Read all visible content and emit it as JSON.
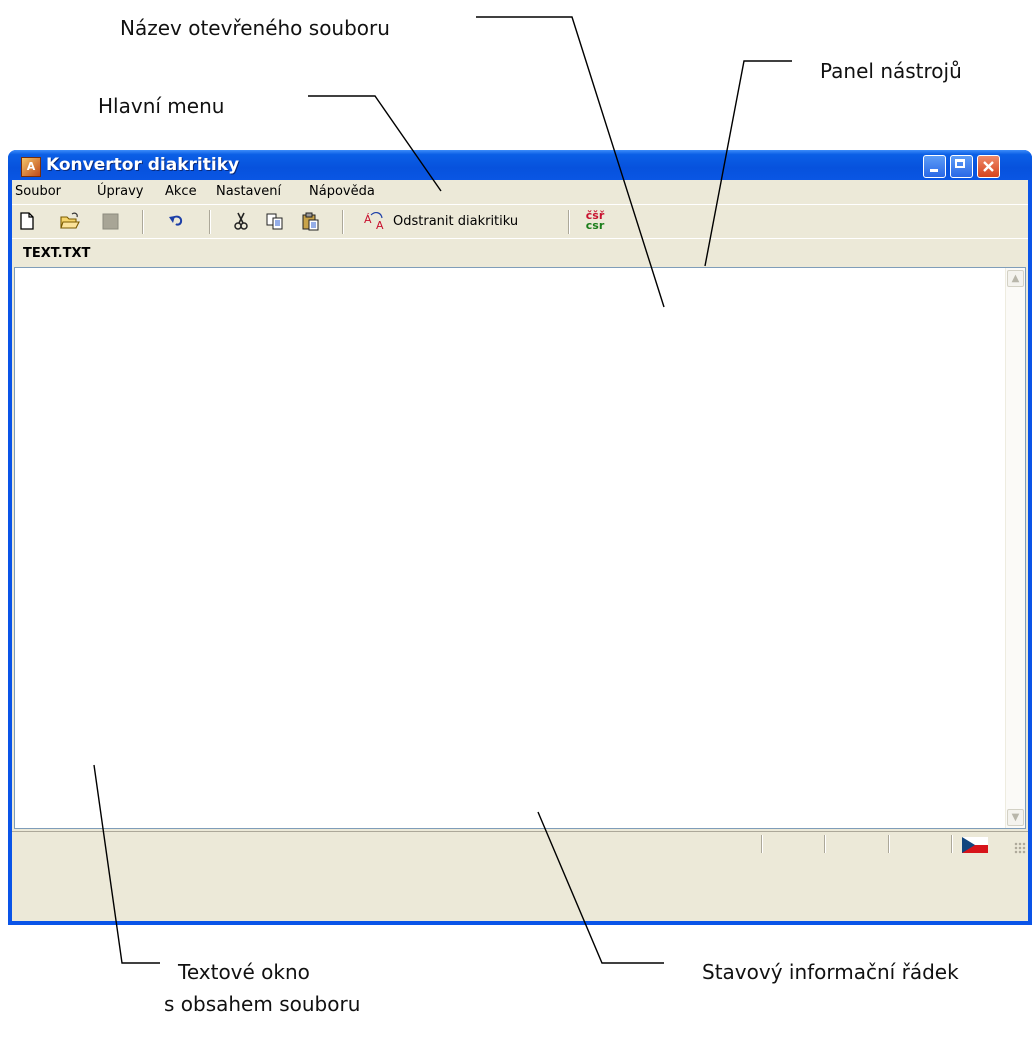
{
  "callouts": {
    "file_name": "Název otevřeného souboru",
    "toolbar": "Panel nástrojů",
    "main_menu": "Hlavní menu",
    "text_window_line1": "Textové okno",
    "text_window_line2": "s obsahem souboru",
    "status_line": "Stavový informační řádek"
  },
  "window": {
    "title": "Konvertor diakritiky"
  },
  "menu": {
    "items": [
      "Soubor",
      "Úpravy",
      "Akce",
      "Nastavení",
      "Nápověda"
    ]
  },
  "toolbar": {
    "remove_diacritics_label": "Odstranit diakritiku",
    "csr_top": "čšř",
    "csr_bottom": "csr"
  },
  "document": {
    "file_name": "TEXT.TXT"
  }
}
